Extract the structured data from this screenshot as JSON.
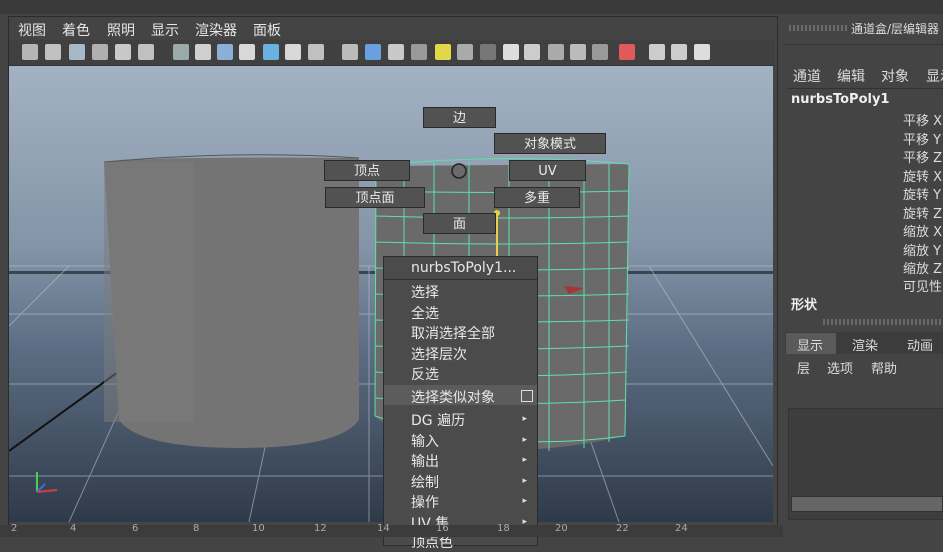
{
  "viewport_menu": [
    "视图",
    "着色",
    "照明",
    "显示",
    "渲染器",
    "面板"
  ],
  "toolbar_icons": [
    "camera-icon",
    "bookmark-icon",
    "film-gate-icon",
    "image-plane-icon",
    "grid-icon",
    "resolution-gate-icon",
    "wireframe-icon",
    "smooth-shade-icon",
    "textured-icon",
    "lights-icon",
    "shadows-icon",
    "ao-icon",
    "isolate-icon",
    "xray-icon",
    "xray-joints-icon",
    "xray-components-icon",
    "bounding-box-icon",
    "cube-icon",
    "cube-shaded-icon",
    "checker-icon",
    "light-bulb-icon",
    "sphere-gray-icon",
    "sphere-dark-icon",
    "sphere-white-icon",
    "ball-icon",
    "half-sphere-icon",
    "sphere-group-icon",
    "select-icon",
    "camera-wire-icon",
    "frame-icon",
    "share-icon"
  ],
  "marking_menu": {
    "edge": "边",
    "object_mode": "对象模式",
    "vertex": "顶点",
    "uv": "UV",
    "vertex_face": "顶点面",
    "multi": "多重",
    "face": "面"
  },
  "context_menu": {
    "header": "nurbsToPoly1...",
    "items": [
      {
        "label": "选择",
        "submenu": false
      },
      {
        "label": "全选",
        "submenu": false
      },
      {
        "label": "取消选择全部",
        "submenu": false
      },
      {
        "label": "选择层次",
        "submenu": false
      },
      {
        "label": "反选",
        "submenu": false
      },
      {
        "label": "选择类似对象",
        "submenu": false,
        "option_box": true
      },
      {
        "label": "DG 遍历",
        "submenu": true
      },
      {
        "label": "输入",
        "submenu": true
      },
      {
        "label": "输出",
        "submenu": true
      },
      {
        "label": "绘制",
        "submenu": true
      },
      {
        "label": "操作",
        "submenu": true
      },
      {
        "label": "UV 集",
        "submenu": true
      },
      {
        "label": "顶点色",
        "submenu": true
      }
    ]
  },
  "ruler_ticks": [
    "2",
    "4",
    "6",
    "8",
    "10",
    "12",
    "14",
    "16",
    "18",
    "20",
    "22",
    "24"
  ],
  "channel_box": {
    "title": "通道盒/层编辑器",
    "menu": [
      "通道",
      "编辑",
      "对象",
      "显示"
    ],
    "node": "nurbsToPoly1",
    "attributes": [
      "平移 X",
      "平移 Y",
      "平移 Z",
      "旋转 X",
      "旋转 Y",
      "旋转 Z",
      "缩放 X",
      "缩放 Y",
      "缩放 Z",
      "可见性"
    ],
    "shapes_label": "形状"
  },
  "layer_editor": {
    "tabs": [
      "显示",
      "渲染",
      "动画"
    ],
    "menu": [
      "层",
      "选项",
      "帮助"
    ]
  },
  "colors": {
    "wire_select": "#5fe0a8",
    "bg_top": "#a3b2c2",
    "bg_bottom": "#2f3a49"
  }
}
